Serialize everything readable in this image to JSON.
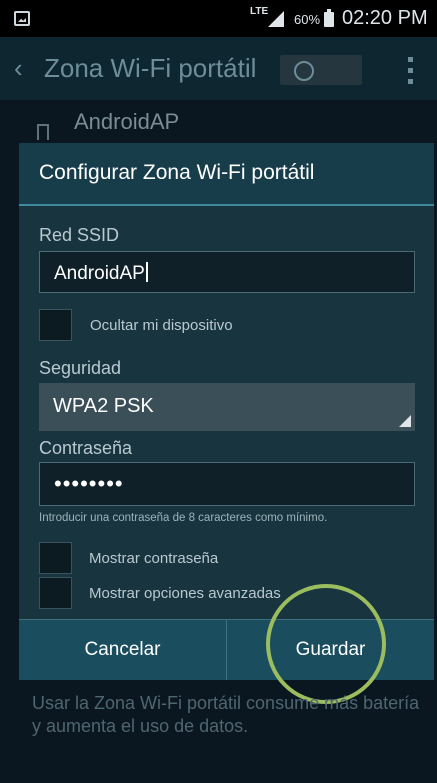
{
  "status_bar": {
    "network": "LTE",
    "battery": "60%",
    "time": "02:20 PM"
  },
  "action_bar": {
    "title": "Zona Wi-Fi portátil"
  },
  "background_list": {
    "network_name": "AndroidAP"
  },
  "dialog": {
    "title": "Configurar Zona Wi-Fi portátil",
    "ssid_label": "Red SSID",
    "ssid_value": "AndroidAP",
    "hide_device_label": "Ocultar mi dispositivo",
    "security_label": "Seguridad",
    "security_value": "WPA2 PSK",
    "password_label": "Contraseña",
    "password_value": "••••••••",
    "password_hint": "Introducir una contraseña de 8 caracteres como mínimo.",
    "show_password_label": "Mostrar contraseña",
    "advanced_label": "Mostrar opciones avanzadas",
    "cancel_label": "Cancelar",
    "save_label": "Guardar"
  },
  "footer_note": "Usar la Zona Wi-Fi portátil consume más batería y aumenta el uso de datos.",
  "colors": {
    "highlight": "#9cbd5e",
    "accent": "#3e8ba0"
  }
}
